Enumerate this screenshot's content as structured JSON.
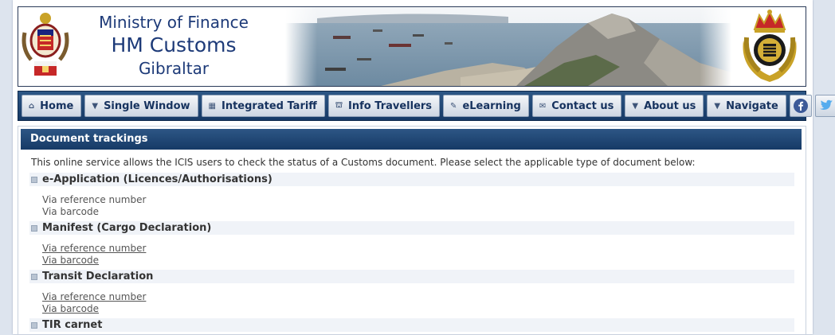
{
  "header": {
    "line1": "Ministry of Finance",
    "line2": "HM Customs",
    "line3": "Gibraltar"
  },
  "nav": {
    "items": [
      {
        "icon": "⌂",
        "icon_name": "home-icon",
        "label": "Home"
      },
      {
        "icon": "▼",
        "icon_name": "dropdown-icon",
        "label": "Single Window"
      },
      {
        "icon": "▦",
        "icon_name": "book-icon",
        "label": "Integrated Tariff"
      },
      {
        "icon": "⛫",
        "icon_name": "building-icon",
        "label": "Info Travellers"
      },
      {
        "icon": "✎",
        "icon_name": "pencil-icon",
        "label": "eLearning"
      },
      {
        "icon": "✉",
        "icon_name": "mail-icon",
        "label": "Contact us"
      },
      {
        "icon": "▼",
        "icon_name": "dropdown-icon",
        "label": "About us"
      },
      {
        "icon": "▼",
        "icon_name": "dropdown-icon",
        "label": "Navigate"
      }
    ],
    "facebook_icon": "facebook-icon",
    "twitter_icon": "twitter-icon"
  },
  "panel": {
    "title": "Document trackings",
    "intro": "This online service allows the ICIS users to check the status of a Customs document. Please select the applicable type of document below:",
    "sections": [
      {
        "title": "e-Application (Licences/Authorisations)",
        "links": [
          "Via reference number",
          "Via barcode"
        ],
        "linked": false
      },
      {
        "title": "Manifest (Cargo Declaration)",
        "links": [
          "Via reference number",
          "Via barcode"
        ],
        "linked": true
      },
      {
        "title": "Transit Declaration",
        "links": [
          "Via reference number",
          "Via barcode"
        ],
        "linked": true
      },
      {
        "title": "TIR carnet",
        "links": [],
        "linked": false
      }
    ]
  },
  "colors": {
    "brand_navy": "#1d3a78",
    "nav_bar": "#163a66",
    "facebook": "#3b5998",
    "twitter": "#55acee"
  }
}
